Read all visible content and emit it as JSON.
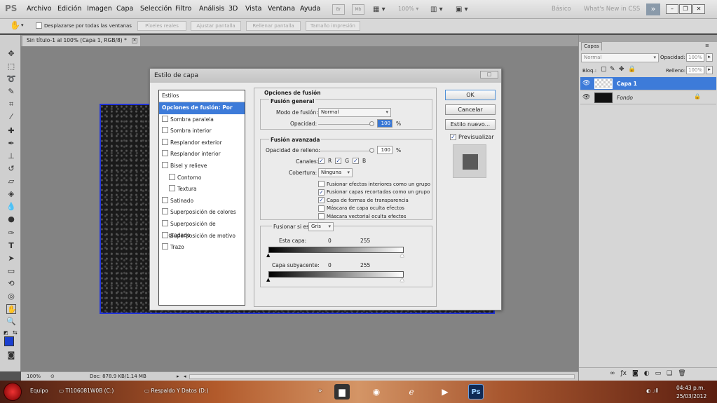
{
  "app": {
    "logo": "PS",
    "menu": [
      "Archivo",
      "Edición",
      "Imagen",
      "Capa",
      "Selección",
      "Filtro",
      "Análisis",
      "3D",
      "Vista",
      "Ventana",
      "Ayuda"
    ],
    "br_label": "Br",
    "mb_label": "Mb",
    "zoom_menu": "100%",
    "workspaces": [
      "Básico",
      "What's New in CSS"
    ]
  },
  "options_bar": {
    "scroll_all_label": "Desplazarse por todas las ventanas",
    "buttons": [
      "Píxeles reales",
      "Ajustar pantalla",
      "Rellenar pantalla",
      "Tamaño impresión"
    ]
  },
  "document": {
    "tab_title": "Sin título-1 al 100% (Capa 1, RGB/8) *",
    "status_zoom": "100%",
    "status_doc": "Doc: 878.9 KB/1.14 MB"
  },
  "dialog": {
    "title": "Estilo de capa",
    "styles_header": "Estilos",
    "styles": [
      {
        "label": "Opciones de fusión: Por defecto",
        "selected": true,
        "checkbox": false,
        "indent": false
      },
      {
        "label": "Sombra paralela",
        "checkbox": true,
        "indent": false
      },
      {
        "label": "Sombra interior",
        "checkbox": true,
        "indent": false
      },
      {
        "label": "Resplandor exterior",
        "checkbox": true,
        "indent": false
      },
      {
        "label": "Resplandor interior",
        "checkbox": true,
        "indent": false
      },
      {
        "label": "Bisel y relieve",
        "checkbox": true,
        "indent": false
      },
      {
        "label": "Contorno",
        "checkbox": true,
        "indent": true
      },
      {
        "label": "Textura",
        "checkbox": true,
        "indent": true
      },
      {
        "label": "Satinado",
        "checkbox": true,
        "indent": false
      },
      {
        "label": "Superposición de colores",
        "checkbox": true,
        "indent": false
      },
      {
        "label": "Superposición de degradado",
        "checkbox": true,
        "indent": false
      },
      {
        "label": "Superposición de motivo",
        "checkbox": true,
        "indent": false
      },
      {
        "label": "Trazo",
        "checkbox": true,
        "indent": false
      }
    ],
    "section_title": "Opciones de fusión",
    "general": {
      "title": "Fusión general",
      "mode_label": "Modo de fusión:",
      "mode_value": "Normal",
      "opacity_label": "Opacidad:",
      "opacity_value": "100",
      "pct": "%"
    },
    "advanced": {
      "title": "Fusión avanzada",
      "fill_label": "Opacidad de relleno:",
      "fill_value": "100",
      "pct": "%",
      "channels_label": "Canales:",
      "channels": [
        "R",
        "G",
        "B"
      ],
      "knockout_label": "Cobertura:",
      "knockout_value": "Ninguna",
      "options": [
        {
          "label": "Fusionar efectos interiores como un grupo",
          "checked": false
        },
        {
          "label": "Fusionar capas recortadas como un grupo",
          "checked": true
        },
        {
          "label": "Capa de formas de transparencia",
          "checked": true
        },
        {
          "label": "Máscara de capa oculta efectos",
          "checked": false
        },
        {
          "label": "Máscara vectorial oculta efectos",
          "checked": false
        }
      ]
    },
    "blend_if": {
      "label": "Fusionar si es:",
      "value": "Gris",
      "this_layer": "Esta capa:",
      "this_min": "0",
      "this_max": "255",
      "underlying": "Capa subyacente:",
      "under_min": "0",
      "under_max": "255"
    },
    "buttons": {
      "ok": "OK",
      "cancel": "Cancelar",
      "new_style": "Estilo nuevo...",
      "preview": "Previsualizar"
    }
  },
  "layers_panel": {
    "tab": "Capas",
    "blend_mode": "Normal",
    "opacity_label": "Opacidad:",
    "opacity_value": "100%",
    "lock_label": "Bloq.:",
    "fill_label": "Relleno:",
    "fill_value": "100%",
    "layers": [
      {
        "name": "Capa 1",
        "selected": true
      },
      {
        "name": "Fondo",
        "selected": false
      }
    ]
  },
  "taskbar": {
    "items": [
      "Equipo",
      "TI106081W0B (C:)",
      "Respaldo Y Datos (D:)"
    ],
    "time": "04:43 p.m.",
    "date": "25/03/2012"
  },
  "colors": {
    "accent": "#3d7bd9",
    "canvas_border": "#2133d8",
    "foreground": "#1a3fd0"
  }
}
